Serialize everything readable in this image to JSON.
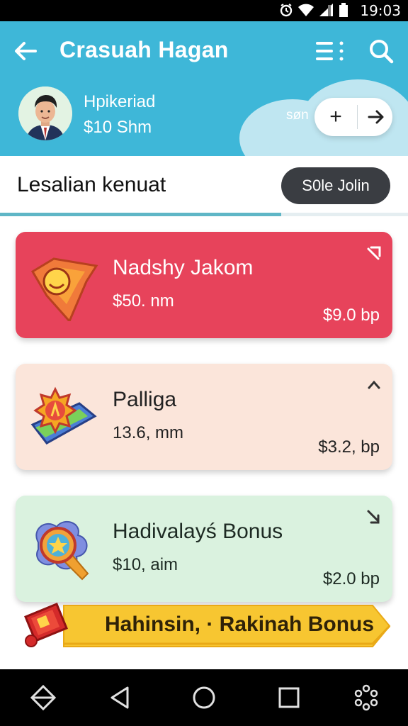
{
  "status_bar": {
    "time": "19:03"
  },
  "app_bar": {
    "title": "Crasuah Hagan"
  },
  "profile": {
    "name": "Hpikeriad",
    "amount": "$10 Shm"
  },
  "header_action": {
    "label": "søn"
  },
  "section": {
    "title": "Lesalian kenuat",
    "button_label": "S0le Jolin"
  },
  "tab_progress": {
    "fraction": 0.69
  },
  "cards": [
    {
      "title": "Nadshy Jakom",
      "subtitle": "$50. nm",
      "price": "$9.0 bp"
    },
    {
      "title": "Palliga",
      "subtitle": "13.6, mm",
      "price": "$3.2, bp"
    },
    {
      "title": "Hadivalayś Bonus",
      "subtitle": "$10, aim",
      "price": "$2.0 bp"
    }
  ],
  "banner": {
    "text": "Hahinsin, · Rakinah Bonus"
  },
  "colors": {
    "header": "#3eb7d8",
    "card_red": "#e7435b",
    "card_peach": "#fbe5da",
    "card_mint": "#daf2df",
    "banner": "#f7c631",
    "pill_dark": "#3a3d42"
  },
  "icons": {
    "status": [
      "alarm-icon",
      "wifi-icon",
      "signal-icon",
      "battery-icon"
    ],
    "app_bar": [
      "back-arrow-icon",
      "menu-icon",
      "search-icon"
    ],
    "stepper": [
      "plus-icon",
      "arrow-right-icon"
    ],
    "cards": [
      "shield-badge-icon",
      "ticket-badge-icon",
      "star-medal-icon"
    ],
    "card_action": "chevron-icon",
    "banner": "gift-ticket-icon",
    "nav": [
      "rotate-icon",
      "back-icon",
      "home-icon",
      "recents-icon",
      "apps-icon"
    ]
  }
}
